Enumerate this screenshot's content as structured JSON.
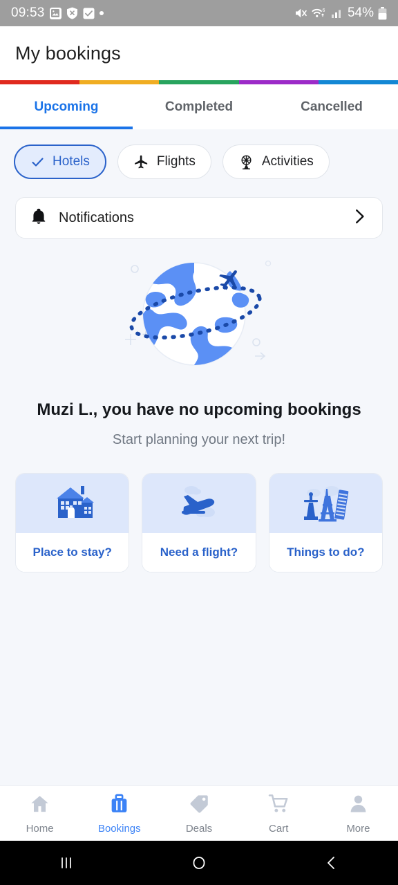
{
  "status_bar": {
    "time": "09:53",
    "left_icons": [
      "photo-icon",
      "shield-x-icon",
      "checkbox-icon",
      "dot-icon"
    ],
    "right_icons": [
      "mute-icon",
      "wifi-icon",
      "signal-icon"
    ],
    "battery_percent": "54%",
    "battery_icon": "battery-icon",
    "background_color": "#9e9e9e"
  },
  "header": {
    "title": "My bookings",
    "stripe_colors": [
      "#e02a1e",
      "#f0ad22",
      "#28a45e",
      "#9c2bc8",
      "#1387d4"
    ]
  },
  "tabs": {
    "items": [
      {
        "label": "Upcoming",
        "active": true
      },
      {
        "label": "Completed",
        "active": false
      },
      {
        "label": "Cancelled",
        "active": false
      }
    ],
    "active_color": "#1a73e8",
    "inactive_color": "#5f6368"
  },
  "filters": {
    "chips": [
      {
        "label": "Hotels",
        "icon": "check-icon",
        "selected": true
      },
      {
        "label": "Flights",
        "icon": "airplane-icon",
        "selected": false
      },
      {
        "label": "Activities",
        "icon": "ferris-wheel-icon",
        "selected": false
      }
    ],
    "selected_bg": "#e3ecfd",
    "selected_border": "#2a62ca"
  },
  "notifications": {
    "label": "Notifications",
    "icon": "bell-icon",
    "chevron": "chevron-right-icon"
  },
  "illustration": {
    "name": "globe-with-airplane-illustration",
    "globe_color": "#5b90f5",
    "airplane_color": "#1a49a8"
  },
  "empty_state": {
    "title": "Muzi L., you have no upcoming bookings",
    "subtitle": "Start planning your next trip!"
  },
  "suggestions": [
    {
      "label": "Place to stay?",
      "icon": "house-icon"
    },
    {
      "label": "Need a flight?",
      "icon": "airplane-takeoff-icon"
    },
    {
      "label": "Things to do?",
      "icon": "landmarks-icon"
    }
  ],
  "bottom_nav": {
    "items": [
      {
        "label": "Home",
        "icon": "home-icon",
        "active": false
      },
      {
        "label": "Bookings",
        "icon": "briefcase-icon",
        "active": true
      },
      {
        "label": "Deals",
        "icon": "tag-icon",
        "active": false
      },
      {
        "label": "Cart",
        "icon": "cart-icon",
        "active": false
      },
      {
        "label": "More",
        "icon": "person-icon",
        "active": false
      }
    ],
    "active_color": "#3b82f6",
    "inactive_color": "#c3cad6"
  },
  "android_nav": {
    "recents": "recents-icon",
    "home": "home-circle-icon",
    "back": "back-chevron-icon"
  }
}
